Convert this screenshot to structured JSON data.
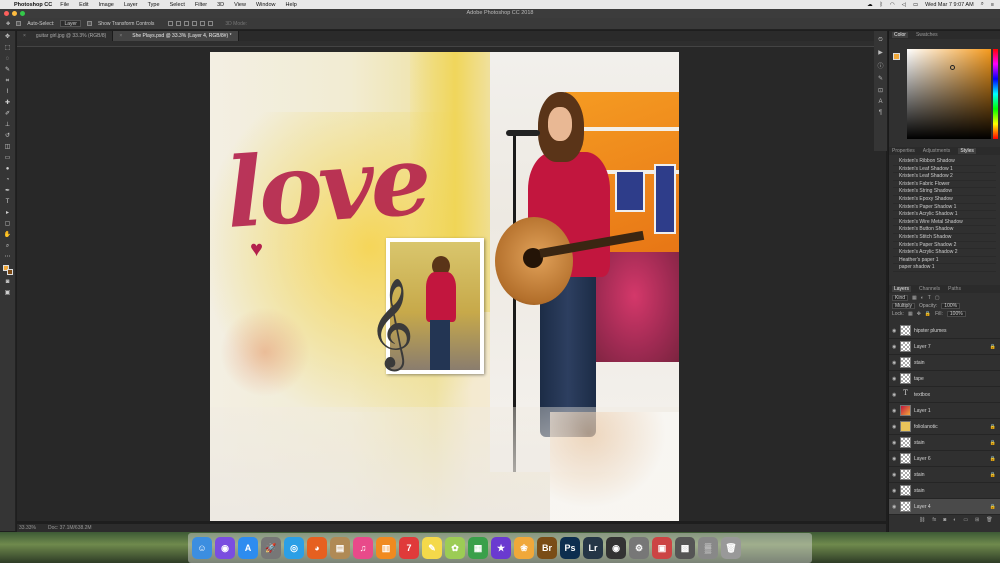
{
  "menubar": {
    "app_name": "Photoshop CC",
    "menus": [
      "File",
      "Edit",
      "Image",
      "Layer",
      "Type",
      "Select",
      "Filter",
      "3D",
      "View",
      "Window",
      "Help"
    ],
    "clock": "Wed Mar 7  9:07 AM"
  },
  "window": {
    "title": "Adobe Photoshop CC 2018"
  },
  "options": {
    "auto_select_label": "Auto-Select:",
    "auto_select_value": "Layer",
    "transform_label": "Show Transform Controls",
    "mode_3d_label": "3D Mode:"
  },
  "tabs": [
    {
      "label": "guitar girl.jpg @ 33.3% (RGB/8)"
    },
    {
      "label": "She Plays.psd @ 33.3% (Layer 4, RGB/8#) *"
    }
  ],
  "status": {
    "zoom": "33.33%",
    "doc": "Doc: 37.1M/638.2M"
  },
  "color_panel": {
    "tabs": [
      "Color",
      "Swatches"
    ],
    "fg_color": "#f0a83a"
  },
  "styles_panel": {
    "tabs": [
      "Properties",
      "Adjustments",
      "Styles"
    ],
    "items": [
      "Kristen's Ribbon Shadow",
      "Kristen's Leaf Shadow 1",
      "Kristen's Leaf Shadow 2",
      "Kristen's Fabric Flower",
      "Kristen's String Shadow",
      "Kristen's Epoxy Shadow",
      "Kristen's Paper Shadow 1",
      "Kristen's Acrylic Shadow 1",
      "Kristen's Wire Metal Shadow",
      "Kristen's Button Shadow",
      "Kristen's Stitch Shadow",
      "Kristen's Paper Shadow 2",
      "Kristen's Acrylic Shadow 2",
      "Heather's paper 1",
      "paper shadow 1"
    ]
  },
  "layers_panel": {
    "tabs": [
      "Layers",
      "Channels",
      "Paths"
    ],
    "filter_value": "Kind",
    "blend_mode": "Multiply",
    "opacity_label": "Opacity:",
    "opacity_value": "100%",
    "lock_label": "Lock:",
    "fill_label": "Fill:",
    "fill_value": "100%",
    "layers": [
      {
        "name": "hipster plumes",
        "kind": "pattern",
        "locked": false
      },
      {
        "name": "Layer 7",
        "kind": "pattern",
        "locked": true
      },
      {
        "name": "stain",
        "kind": "pattern",
        "locked": false
      },
      {
        "name": "tape",
        "kind": "pattern",
        "locked": false
      },
      {
        "name": "textbox",
        "kind": "text",
        "locked": false
      },
      {
        "name": "Layer 1",
        "kind": "photo",
        "locked": false
      },
      {
        "name": "foliolanotic",
        "kind": "yellow",
        "locked": true
      },
      {
        "name": "stain",
        "kind": "pattern",
        "locked": true
      },
      {
        "name": "Layer 6",
        "kind": "pattern",
        "locked": true
      },
      {
        "name": "stain",
        "kind": "pattern",
        "locked": true
      },
      {
        "name": "stain",
        "kind": "pattern",
        "locked": false
      },
      {
        "name": "Layer 4",
        "kind": "pattern",
        "locked": true,
        "active": true
      }
    ]
  },
  "dock": {
    "icons": [
      {
        "name": "finder-icon",
        "glyph": "☺",
        "color": "#3c8ee0"
      },
      {
        "name": "siri-icon",
        "glyph": "◉",
        "color": "#7a4de0"
      },
      {
        "name": "app-store-icon",
        "glyph": "A",
        "color": "#2d8cf0"
      },
      {
        "name": "launchpad-icon",
        "glyph": "🚀",
        "color": "#777"
      },
      {
        "name": "safari-icon",
        "glyph": "◎",
        "color": "#2b9fe6"
      },
      {
        "name": "firefox-icon",
        "glyph": "◕",
        "color": "#e66020"
      },
      {
        "name": "notes-folder-icon",
        "glyph": "▤",
        "color": "#b08a55"
      },
      {
        "name": "itunes-icon",
        "glyph": "♫",
        "color": "#e84a8a"
      },
      {
        "name": "ibooks-icon",
        "glyph": "▥",
        "color": "#f08a20"
      },
      {
        "name": "calendar-icon",
        "glyph": "7",
        "color": "#e03a3a"
      },
      {
        "name": "notes-icon",
        "glyph": "✎",
        "color": "#f4d94a"
      },
      {
        "name": "photos-icon",
        "glyph": "✿",
        "color": "#9ccc55"
      },
      {
        "name": "numbers-icon",
        "glyph": "▦",
        "color": "#3aa04a"
      },
      {
        "name": "imovie-icon",
        "glyph": "★",
        "color": "#6a3ad0"
      },
      {
        "name": "photos-app-icon",
        "glyph": "❀",
        "color": "#f0a83a"
      },
      {
        "name": "bridge-icon",
        "glyph": "Br",
        "color": "#7a4d16"
      },
      {
        "name": "photoshop-icon",
        "glyph": "Ps",
        "color": "#0d2e4f"
      },
      {
        "name": "lightroom-icon",
        "glyph": "Lr",
        "color": "#253646"
      },
      {
        "name": "dvd-player-icon",
        "glyph": "◉",
        "color": "#333"
      },
      {
        "name": "system-preferences-icon",
        "glyph": "⚙",
        "color": "#777"
      },
      {
        "name": "calendar-alt-icon",
        "glyph": "▣",
        "color": "#c44"
      },
      {
        "name": "calculator-icon",
        "glyph": "▩",
        "color": "#555"
      },
      {
        "name": "downloads-icon",
        "glyph": "▒",
        "color": "#888"
      },
      {
        "name": "trash-icon",
        "glyph": "🗑",
        "color": "#999"
      }
    ]
  }
}
